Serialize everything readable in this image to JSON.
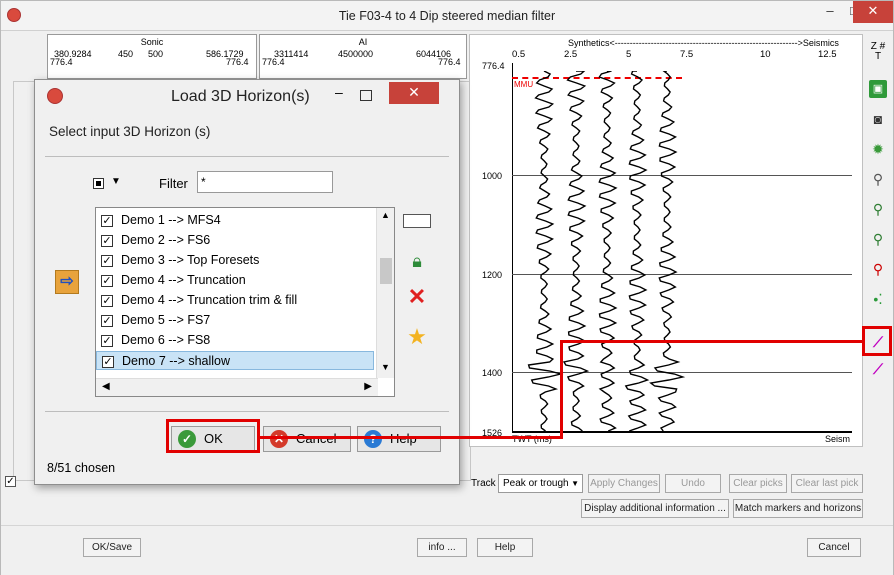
{
  "window": {
    "title": "Tie F03-4 to 4 Dip steered median filter",
    "minimize": "–",
    "maximize": "□",
    "close": "✕"
  },
  "logs": {
    "sonic": {
      "name": "Sonic",
      "min": "380.9284",
      "v1": "450",
      "v2": "500",
      "max": "586.1729",
      "depth_left": "776.4",
      "depth_right": "776.4"
    },
    "ai": {
      "name": "AI",
      "min": "3311414",
      "mid": "4500000",
      "max": "6044106",
      "depth_left": "776.4",
      "depth_right": "776.4"
    }
  },
  "plot": {
    "header": "Synthetics<------------------------------------------------------------->Seismics",
    "x_ticks": [
      "0.5",
      "2.5",
      "5",
      "7.5",
      "10",
      "12.5"
    ],
    "top_depth": "776.4",
    "y_ticks": [
      "1000",
      "1200",
      "1400",
      "1526"
    ],
    "marker": "MMU",
    "x_axis_label": "TWT (ms)",
    "seismics_label": "Seism",
    "icon_z": "Z #",
    "icon_t": "T"
  },
  "track": {
    "label": "Track",
    "mode": "Peak or trough",
    "apply": "Apply Changes",
    "undo": "Undo",
    "clear_picks": "Clear picks",
    "clear_last": "Clear last pick",
    "display_info": "Display additional information ...",
    "match": "Match markers and horizons"
  },
  "bottom": {
    "ok_save": "OK/Save",
    "info": "info ...",
    "help": "Help",
    "cancel": "Cancel"
  },
  "dialog": {
    "title": "Load 3D Horizon(s)",
    "minimize": "–",
    "close": "✕",
    "prompt": "Select input 3D Horizon (s)",
    "filter_label": "Filter",
    "filter_value": "*",
    "items": [
      {
        "label": "Demo 1 --> MFS4",
        "checked": "✓"
      },
      {
        "label": "Demo 2 --> FS6",
        "checked": "✓"
      },
      {
        "label": "Demo 3  --> Top Foresets",
        "checked": "✓"
      },
      {
        "label": "Demo 4 --> Truncation",
        "checked": "✓"
      },
      {
        "label": "Demo 4 --> Truncation trim & fill",
        "checked": "✓"
      },
      {
        "label": "Demo 5 --> FS7",
        "checked": "✓"
      },
      {
        "label": "Demo 6 --> FS8",
        "checked": "✓"
      },
      {
        "label": "Demo 7 --> shallow",
        "checked": "✓"
      }
    ],
    "ok": "OK",
    "cancel": "Cancel",
    "help": "Help",
    "chosen": "8/51 chosen"
  },
  "colors": {
    "highlight": "#e10000",
    "selection": "#c9e3f6",
    "close_red": "#c7423a"
  }
}
